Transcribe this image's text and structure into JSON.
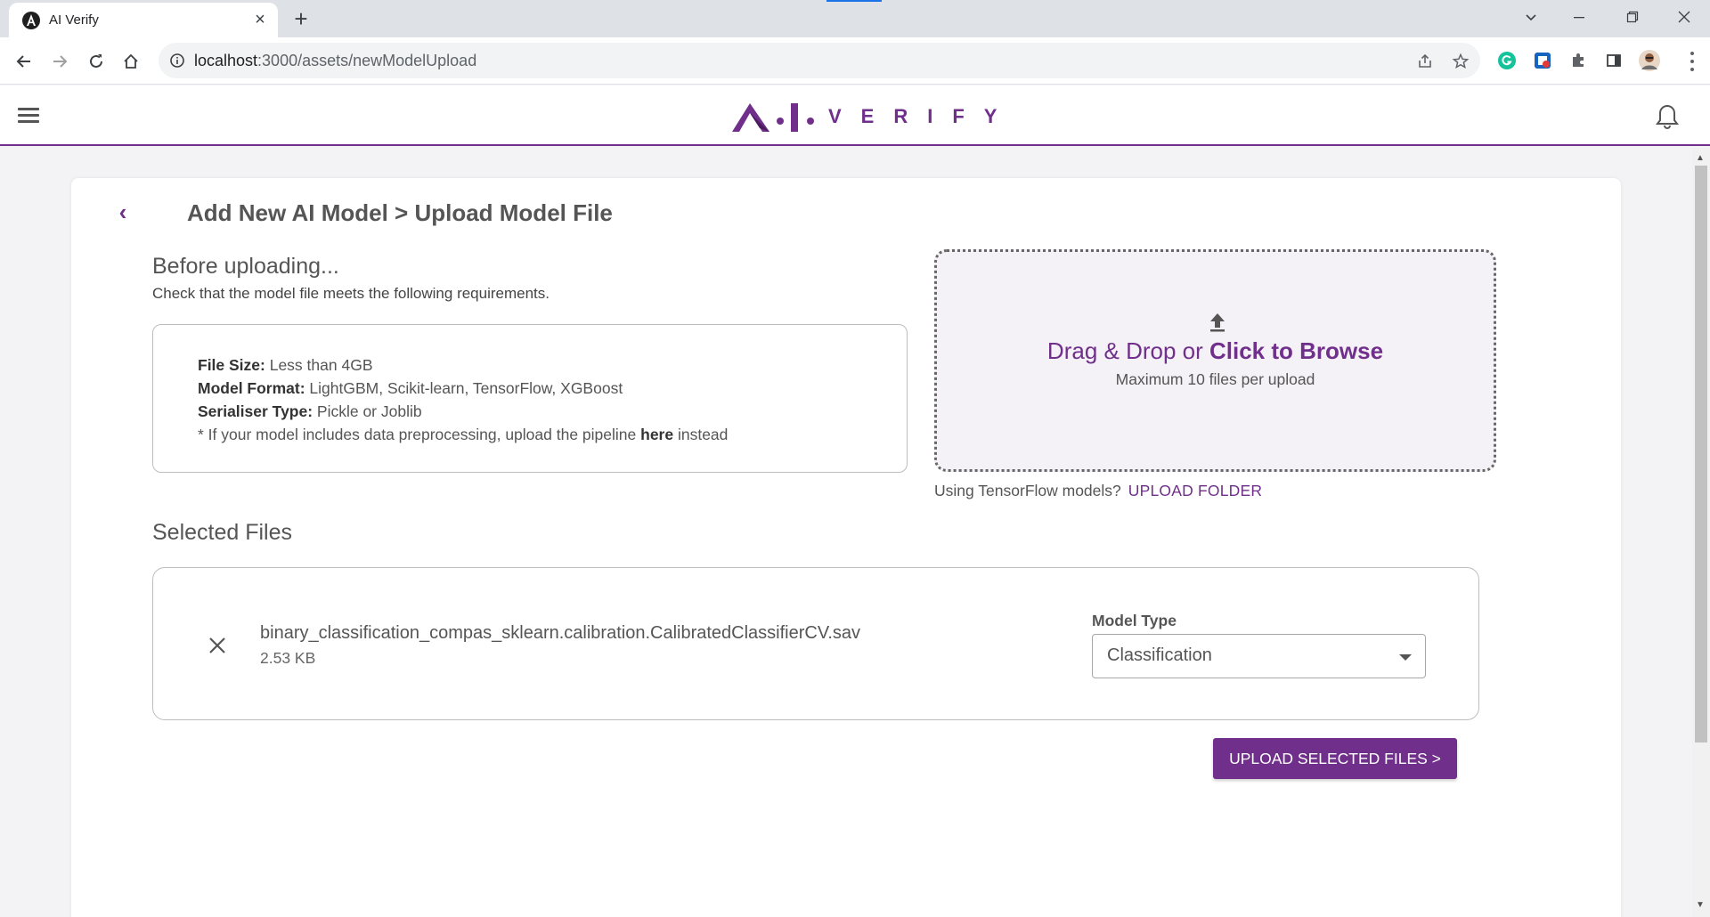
{
  "browser": {
    "tab_title": "AI Verify",
    "tab_close": "×",
    "new_tab": "+",
    "url_host": "localhost",
    "url_path": ":3000/assets/newModelUpload"
  },
  "header": {
    "logo_text": "VERIFY"
  },
  "page": {
    "back": "‹",
    "title": "Add New AI Model > Upload Model File"
  },
  "before": {
    "title": "Before uploading...",
    "subtitle": "Check that the model file meets the following requirements.",
    "requirements": [
      {
        "label": "File Size:",
        "value": " Less than 4GB"
      },
      {
        "label": "Model Format:",
        "value": " LightGBM, Scikit-learn, TensorFlow, XGBoost"
      },
      {
        "label": "Serialiser Type:",
        "value": " Pickle or Joblib"
      }
    ],
    "note_prefix": "* If your model includes data preprocessing, upload the pipeline ",
    "note_link": "here",
    "note_suffix": " instead"
  },
  "dropzone": {
    "text_prefix": "Drag & Drop or ",
    "text_bold": "Click to Browse",
    "max_text": "Maximum 10 files per upload",
    "tf_question": "Using TensorFlow models?",
    "tf_link": "UPLOAD FOLDER"
  },
  "selected": {
    "title": "Selected Files",
    "files": [
      {
        "name": "binary_classification_compas_sklearn.calibration.CalibratedClassifierCV.sav",
        "size": "2.53 KB",
        "model_type_label": "Model Type",
        "model_type_value": "Classification"
      }
    ]
  },
  "actions": {
    "upload_button": "UPLOAD SELECTED FILES >"
  },
  "colors": {
    "brand": "#702f8a",
    "background": "#f3f2f5"
  }
}
